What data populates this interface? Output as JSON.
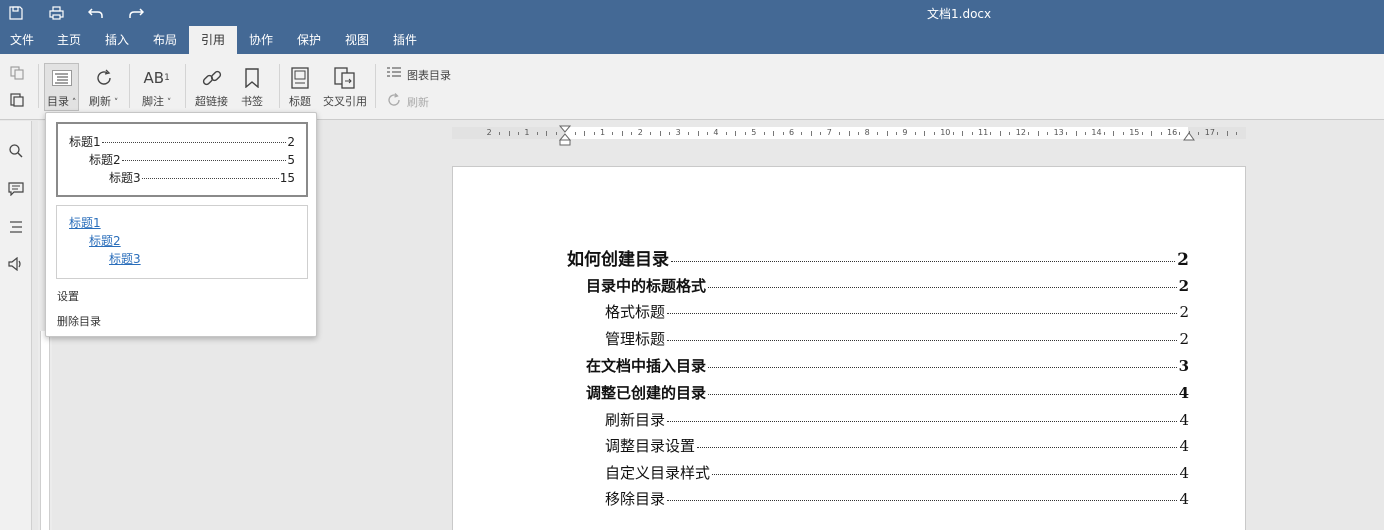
{
  "window": {
    "title": "文档1.docx"
  },
  "quick_access": [
    "save-icon",
    "print-icon",
    "undo-icon",
    "redo-icon"
  ],
  "tabs": [
    {
      "label": "文件"
    },
    {
      "label": "主页"
    },
    {
      "label": "插入"
    },
    {
      "label": "布局"
    },
    {
      "label": "引用"
    },
    {
      "label": "协作"
    },
    {
      "label": "保护"
    },
    {
      "label": "视图"
    },
    {
      "label": "插件"
    }
  ],
  "active_tab": "引用",
  "toolbar": {
    "toc": "目录",
    "refresh": "刷新",
    "footnote": "脚注",
    "hyperlink": "超链接",
    "bookmark": "书签",
    "caption": "标题",
    "cross_ref": "交叉引用",
    "table_of_figures": "图表目录",
    "refresh2": "刷新"
  },
  "dropdown": {
    "preview1": [
      {
        "text": "标题1",
        "page": "2"
      },
      {
        "text": "标题2",
        "page": "5"
      },
      {
        "text": "标题3",
        "page": "15"
      }
    ],
    "preview2": [
      "标题1",
      "标题2",
      "标题3"
    ],
    "settings": "设置",
    "delete": "删除目录"
  },
  "ruler": {
    "numbers": [
      "2",
      "1",
      "",
      "1",
      "2",
      "3",
      "4",
      "5",
      "6",
      "7",
      "8",
      "9",
      "10",
      "11",
      "12",
      "13",
      "14",
      "15",
      "16",
      "17"
    ]
  },
  "toc_entries": [
    {
      "text": "如何创建目录",
      "page": "2",
      "level": 1
    },
    {
      "text": "目录中的标题格式",
      "page": "2",
      "level": 2
    },
    {
      "text": "格式标题",
      "page": "2",
      "level": 3
    },
    {
      "text": "管理标题",
      "page": "2",
      "level": 3
    },
    {
      "text": "在文档中插入目录",
      "page": "3",
      "level": 2
    },
    {
      "text": "调整已创建的目录",
      "page": "4",
      "level": 2
    },
    {
      "text": "刷新目录",
      "page": "4",
      "level": 3
    },
    {
      "text": "调整目录设置",
      "page": "4",
      "level": 3
    },
    {
      "text": "自定义目录样式",
      "page": "4",
      "level": 3
    },
    {
      "text": "移除目录",
      "page": "4",
      "level": 3
    }
  ],
  "colors": {
    "brand": "#446995",
    "toolbar_bg": "#f1f1f1",
    "link": "#2a6ebb"
  }
}
